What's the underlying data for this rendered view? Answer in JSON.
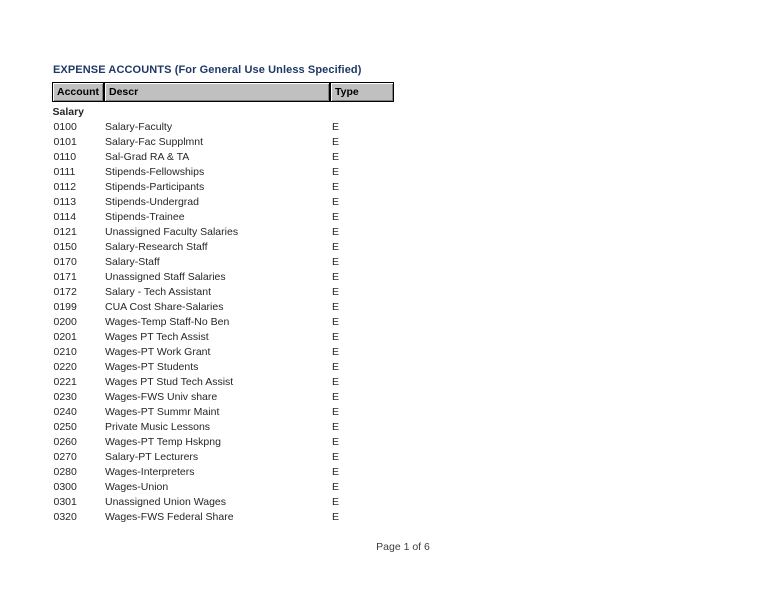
{
  "document": {
    "title": "EXPENSE ACCOUNTS (For General Use Unless Specified)",
    "title_color": "#1f3864",
    "background_color": "#ffffff",
    "header_fill_color": "#c0c0c0"
  },
  "table": {
    "columns": [
      {
        "key": "account",
        "label": "Account"
      },
      {
        "key": "descr",
        "label": "Descr"
      },
      {
        "key": "type",
        "label": "Type"
      }
    ],
    "groups": [
      {
        "label": "Salary",
        "rows": [
          {
            "account": "0100",
            "descr": "Salary-Faculty",
            "type": "E"
          },
          {
            "account": "0101",
            "descr": "Salary-Fac Supplmnt",
            "type": "E"
          },
          {
            "account": "0110",
            "descr": "Sal-Grad RA & TA",
            "type": "E"
          },
          {
            "account": "0111",
            "descr": "Stipends-Fellowships",
            "type": "E"
          },
          {
            "account": "0112",
            "descr": "Stipends-Participants",
            "type": "E"
          },
          {
            "account": "0113",
            "descr": "Stipends-Undergrad",
            "type": "E"
          },
          {
            "account": "0114",
            "descr": "Stipends-Trainee",
            "type": "E"
          },
          {
            "account": "0121",
            "descr": "Unassigned Faculty Salaries",
            "type": "E"
          },
          {
            "account": "0150",
            "descr": "Salary-Research Staff",
            "type": "E"
          },
          {
            "account": "0170",
            "descr": "Salary-Staff",
            "type": "E"
          },
          {
            "account": "0171",
            "descr": "Unassigned Staff Salaries",
            "type": "E"
          },
          {
            "account": "0172",
            "descr": "Salary - Tech Assistant",
            "type": "E"
          },
          {
            "account": "0199",
            "descr": "CUA Cost Share-Salaries",
            "type": "E"
          },
          {
            "account": "0200",
            "descr": "Wages-Temp Staff-No Ben",
            "type": "E"
          },
          {
            "account": "0201",
            "descr": "Wages PT Tech Assist",
            "type": "E"
          },
          {
            "account": "0210",
            "descr": "Wages-PT Work Grant",
            "type": "E"
          },
          {
            "account": "0220",
            "descr": "Wages-PT Students",
            "type": "E"
          },
          {
            "account": "0221",
            "descr": "Wages PT Stud Tech Assist",
            "type": "E"
          },
          {
            "account": "0230",
            "descr": "Wages-FWS Univ share",
            "type": "E"
          },
          {
            "account": "0240",
            "descr": "Wages-PT Summr Maint",
            "type": "E"
          },
          {
            "account": "0250",
            "descr": "Private Music Lessons",
            "type": "E"
          },
          {
            "account": "0260",
            "descr": "Wages-PT Temp Hskpng",
            "type": "E"
          },
          {
            "account": "0270",
            "descr": "Salary-PT Lecturers",
            "type": "E"
          },
          {
            "account": "0280",
            "descr": "Wages-Interpreters",
            "type": "E"
          },
          {
            "account": "0300",
            "descr": "Wages-Union",
            "type": "E"
          },
          {
            "account": "0301",
            "descr": "Unassigned Union Wages",
            "type": "E"
          },
          {
            "account": "0320",
            "descr": "Wages-FWS Federal Share",
            "type": "E"
          }
        ]
      }
    ]
  },
  "footer": {
    "page_label": "Page 1 of 6",
    "page_number": 1,
    "page_total": 6
  }
}
